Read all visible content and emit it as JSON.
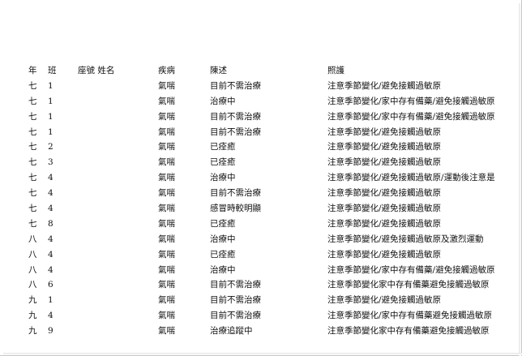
{
  "headers": {
    "grade": "年",
    "class": "班",
    "seat_name": "座號 姓名",
    "illness": "疾病",
    "condition": "陳述",
    "care": "照護"
  },
  "rows": [
    {
      "grade": "七",
      "class": "1",
      "illness": "氣喘",
      "condition": "目前不需治療",
      "care": "注意季節變化/避免接觸過敏原"
    },
    {
      "grade": "七",
      "class": "1",
      "illness": "氣喘",
      "condition": "治療中",
      "care": "注意季節變化/家中存有備藥/避免接觸過敏原"
    },
    {
      "grade": "七",
      "class": "1",
      "illness": "氣喘",
      "condition": "目前不需治療",
      "care": "注意季節變化/家中存有備藥/避免接觸過敏原"
    },
    {
      "grade": "七",
      "class": "1",
      "illness": "氣喘",
      "condition": "目前不需治療",
      "care": "注意季節變化/避免接觸過敏原"
    },
    {
      "grade": "七",
      "class": "2",
      "illness": "氣喘",
      "condition": "已痊癒",
      "care": "注意季節變化/避免接觸過敏原"
    },
    {
      "grade": "七",
      "class": "3",
      "illness": "氣喘",
      "condition": "已痊癒",
      "care": "注意季節變化/避免接觸過敏原"
    },
    {
      "grade": "七",
      "class": "4",
      "illness": "氣喘",
      "condition": "治療中",
      "care": "注意季節變化/避免接觸過敏原/運動後注意是"
    },
    {
      "grade": "七",
      "class": "4",
      "illness": "氣喘",
      "condition": "目前不需治療",
      "care": "注意季節變化/避免接觸過敏原"
    },
    {
      "grade": "七",
      "class": "4",
      "illness": "氣喘",
      "condition": "感冒時較明顯",
      "care": "注意季節變化/避免接觸過敏原"
    },
    {
      "grade": "七",
      "class": "8",
      "illness": "氣喘",
      "condition": "已痊癒",
      "care": "注意季節變化/避免接觸過敏原"
    },
    {
      "grade": "八",
      "class": "4",
      "illness": "氣喘",
      "condition": "治療中",
      "care": "注意季節變化/避免接觸過敏原及激烈運動"
    },
    {
      "grade": "八",
      "class": "4",
      "illness": "氣喘",
      "condition": "已痊癒",
      "care": "注意季節變化/避免接觸過敏原"
    },
    {
      "grade": "八",
      "class": "4",
      "illness": "氣喘",
      "condition": "治療中",
      "care": "注意季節變化/家中存有備藥/避免接觸過敏原"
    },
    {
      "grade": "八",
      "class": "6",
      "illness": "氣喘",
      "condition": "目前不需治療",
      "care": "注意季節變化家中存有備藥避免接觸過敏原"
    },
    {
      "grade": "九",
      "class": "1",
      "illness": "氣喘",
      "condition": "目前不需治療",
      "care": "注意季節變化/避免接觸過敏原"
    },
    {
      "grade": "九",
      "class": "4",
      "illness": "氣喘",
      "condition": "目前不需治療",
      "care": "注意季節變化/家中存有備藥避免接觸過敏原"
    },
    {
      "grade": "九",
      "class": "9",
      "illness": "氣喘",
      "condition": "治療追蹤中",
      "care": "注意季節變化家中存有備藥避免接觸過敏原"
    }
  ]
}
